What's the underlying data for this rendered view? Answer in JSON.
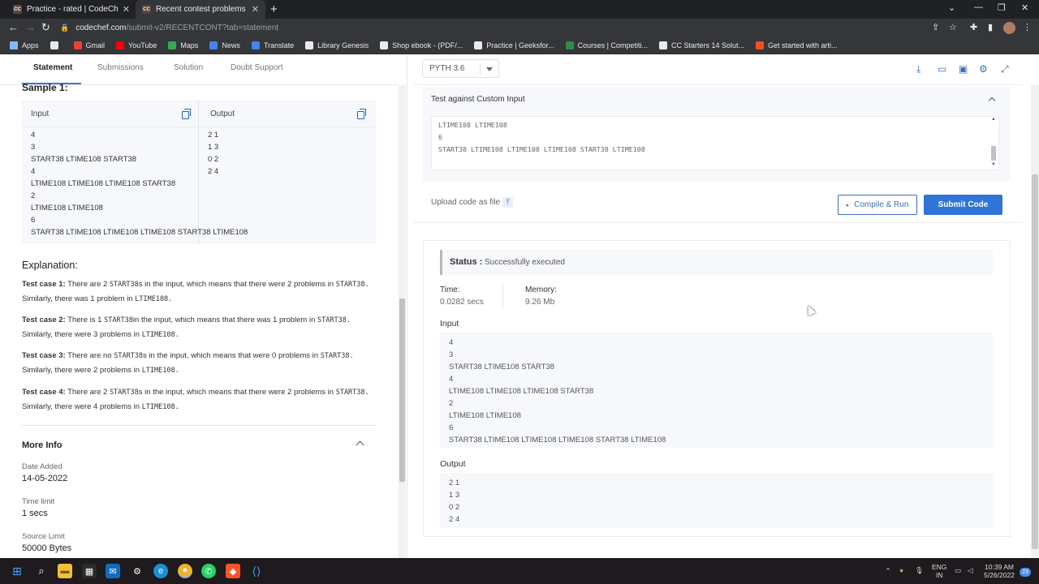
{
  "browser": {
    "tabs": [
      {
        "favicon": "CC",
        "title": "Practice - rated | CodeChef"
      },
      {
        "favicon": "CC",
        "title": "Recent contest problems - Submi"
      }
    ],
    "url_host": "codechef.com",
    "url_path": "/submit-v2/RECENTCONT?tab=statement",
    "bookmarks": [
      {
        "label": "Apps",
        "icon": "apps-grid-icon",
        "color": "#8ab4f8"
      },
      {
        "label": "",
        "icon": "github-icon",
        "color": "#e8eaed"
      },
      {
        "label": "Gmail",
        "icon": "gmail-icon",
        "color": "#ea4335"
      },
      {
        "label": "YouTube",
        "icon": "youtube-icon",
        "color": "#ff0000"
      },
      {
        "label": "Maps",
        "icon": "maps-icon",
        "color": "#34a853"
      },
      {
        "label": "News",
        "icon": "news-icon",
        "color": "#4285f4"
      },
      {
        "label": "Translate",
        "icon": "translate-icon",
        "color": "#4285f4"
      },
      {
        "label": "Library Genesis",
        "icon": "book-icon",
        "color": "#e8eaed"
      },
      {
        "label": "Shop ebook - (PDF/...",
        "icon": "globe-icon",
        "color": "#e8eaed"
      },
      {
        "label": "Practice | Geeksfor...",
        "icon": "globe-icon",
        "color": "#e8eaed"
      },
      {
        "label": "Courses | Competiti...",
        "icon": "gfg-icon",
        "color": "#2f8d46"
      },
      {
        "label": "CC Starters 14 Solut...",
        "icon": "globe-icon",
        "color": "#e8eaed"
      },
      {
        "label": "Get started with arti...",
        "icon": "microsoft-icon",
        "color": "#f25022"
      }
    ]
  },
  "problem_tabs": [
    "Statement",
    "Submissions",
    "Solution",
    "Doubt Support"
  ],
  "sample": {
    "title": "Sample 1:",
    "input_label": "Input",
    "output_label": "Output",
    "input_lines": [
      "4",
      "3",
      "START38 LTIME108 START38",
      "4",
      "LTIME108 LTIME108 LTIME108 START38",
      "2",
      "LTIME108 LTIME108",
      "6",
      "START38 LTIME108 LTIME108 LTIME108 START38 LTIME108"
    ],
    "output_lines": [
      "2 1",
      "1 3",
      "0 2",
      "2 4"
    ]
  },
  "explanation": {
    "title": "Explanation:",
    "cases": [
      {
        "label": "Test case 1:",
        "l1a": "There are",
        "n1": "2",
        "code1": "START38",
        "l1b": "s in the input, which means that there were",
        "n2": "2",
        "l1c": "problems in",
        "code2": "START38.",
        "l2a": "Similarly, there was",
        "n3": "1",
        "l2b": "problem in",
        "code3": "LTIME108."
      },
      {
        "label": "Test case 2:",
        "l1a": "There is",
        "n1": "1",
        "code1": "START38",
        "l1b": "in the input, which means that there was",
        "n2": "1",
        "l1c": "problem in",
        "code2": "START38.",
        "l2a": "Similarly, there were",
        "n3": "3",
        "l2b": "problems in",
        "code3": "LTIME108."
      },
      {
        "label": "Test case 3:",
        "l1a": "There are no",
        "n1": "",
        "code1": "START38",
        "l1b": "s in the input, which means that were",
        "n2": "0",
        "l1c": "problems in",
        "code2": "START38.",
        "l2a": "Similarly, there were",
        "n3": "2",
        "l2b": "problems in",
        "code3": "LTIME108."
      },
      {
        "label": "Test case 4:",
        "l1a": "There are",
        "n1": "2",
        "code1": "START38",
        "l1b": "s in the input, which means that there were",
        "n2": "2",
        "l1c": "problems in",
        "code2": "START38.",
        "l2a": "Similarly, there were",
        "n3": "4",
        "l2b": "problems in",
        "code3": "LTIME108."
      }
    ]
  },
  "more_info": {
    "title": "More Info",
    "date_label": "Date Added",
    "date_value": "14-05-2022",
    "time_label": "Time limit",
    "time_value": "1 secs",
    "source_label": "Source Limit",
    "source_value": "50000 Bytes"
  },
  "editor": {
    "language": "PYTH 3.6",
    "custom_title": "Test against Custom Input",
    "custom_lines": [
      "LTIME108 LTIME108",
      "6",
      "START38 LTIME108 LTIME108 LTIME108 START38 LTIME108"
    ],
    "upload_label": "Upload code as file",
    "compile_label": "Compile & Run",
    "submit_label": "Submit Code"
  },
  "result": {
    "status_label": "Status :",
    "status_value": "Successfully executed",
    "time_label": "Time:",
    "time_value": "0.0282 secs",
    "memory_label": "Memory:",
    "memory_value": "9.26 Mb",
    "input_title": "Input",
    "input_lines": [
      "4",
      "3",
      "START38 LTIME108 START38",
      "4",
      "LTIME108 LTIME108 LTIME108 START38",
      "2",
      "LTIME108 LTIME108",
      "6",
      "START38 LTIME108 LTIME108 LTIME108 START38 LTIME108"
    ],
    "output_title": "Output",
    "output_lines": [
      "2 1",
      "1 3",
      "0 2",
      "2 4"
    ]
  },
  "taskbar": {
    "lang_top": "ENG",
    "lang_bottom": "IN",
    "time": "10:39 AM",
    "date": "5/26/2022",
    "notifications": "23"
  },
  "colors": {
    "accent": "#2f74d6",
    "tab_underline": "#3b78d8"
  }
}
